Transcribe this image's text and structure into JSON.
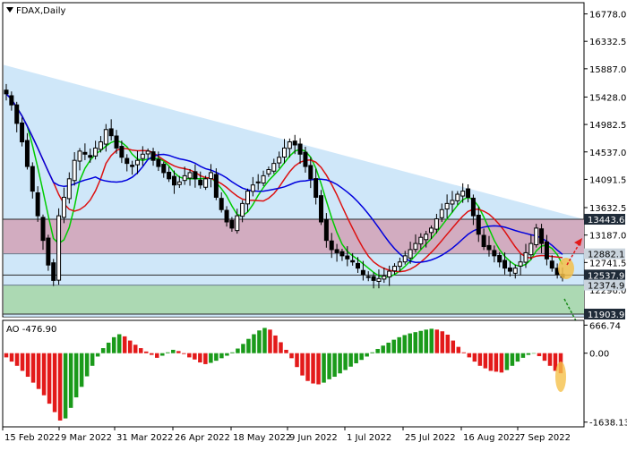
{
  "chart_data": [
    {
      "type": "candlestick",
      "title": "FDAX,Daily",
      "y_ticks": [
        "16778.0",
        "16332.5",
        "15887.0",
        "15428.0",
        "14982.5",
        "14537.0",
        "14091.5",
        "13632.5",
        "13187.0",
        "12741.5",
        "12296.0"
      ],
      "price_labels": [
        {
          "text": "13443.6",
          "value": 13443.6,
          "style": "dark"
        },
        {
          "text": "12882.1",
          "value": 12882.1,
          "style": "light"
        },
        {
          "text": "12537.9",
          "value": 12537.9,
          "style": "dark"
        },
        {
          "text": "12374.9",
          "value": 12374.9,
          "style": "light"
        },
        {
          "text": "11903.9",
          "value": 11903.9,
          "style": "dark"
        }
      ],
      "ylim": [
        11860,
        16960
      ],
      "zones": [
        {
          "from": 12882.1,
          "to": 13443.6,
          "color": "#d4a5b8"
        },
        {
          "from": 11903.9,
          "to": 12374.9,
          "color": "#a9d8a9"
        }
      ],
      "trend_channel": {
        "upper_start": 15950,
        "upper_end": 13443.6,
        "color": "#c3e1f7"
      },
      "moving_averages": [
        {
          "color": "#00cc00"
        },
        {
          "color": "#dd1111"
        },
        {
          "color": "#0000dd"
        }
      ],
      "close_series": [
        15480,
        15300,
        15000,
        14700,
        14300,
        13900,
        13500,
        13100,
        12700,
        12450,
        13500,
        13800,
        14100,
        14400,
        14550,
        14500,
        14450,
        14600,
        14700,
        14900,
        14800,
        14600,
        14450,
        14350,
        14300,
        14400,
        14500,
        14550,
        14400,
        14300,
        14200,
        14100,
        14000,
        14050,
        14150,
        14200,
        14100,
        14000,
        14100,
        14200,
        13800,
        13600,
        13400,
        13300,
        13500,
        13700,
        13900,
        14000,
        14050,
        14150,
        14250,
        14350,
        14450,
        14600,
        14700,
        14650,
        14500,
        14300,
        14100,
        13800,
        13400,
        13100,
        12950,
        12900,
        12850,
        12800,
        12750,
        12650,
        12550,
        12500,
        12450,
        12480,
        12520,
        12600,
        12680,
        12750,
        12850,
        12950,
        13050,
        13150,
        13200,
        13300,
        13450,
        13600,
        13700,
        13750,
        13850,
        13900,
        13800,
        13500,
        13200,
        13000,
        12950,
        12850,
        12750,
        12650,
        12600,
        12650,
        12750,
        12900,
        13050,
        13300,
        13050,
        12800,
        12650,
        12550,
        12500
      ]
    },
    {
      "type": "histogram",
      "title": "AO -476.90",
      "y_ticks": [
        "666.74",
        "0.00",
        "-1638.13"
      ],
      "ylim": [
        -1750,
        780
      ],
      "positive_color": "#1a9a1a",
      "negative_color": "#e31a1a",
      "highlight_color": "#f5a623",
      "values": [
        -100,
        -200,
        -300,
        -420,
        -560,
        -700,
        -850,
        -1000,
        -1200,
        -1400,
        -1600,
        -1550,
        -1300,
        -1050,
        -800,
        -550,
        -300,
        -80,
        120,
        250,
        380,
        450,
        400,
        300,
        200,
        120,
        40,
        -40,
        -110,
        -60,
        20,
        80,
        50,
        -20,
        -100,
        -150,
        -220,
        -260,
        -230,
        -180,
        -120,
        -60,
        20,
        110,
        220,
        340,
        450,
        540,
        600,
        560,
        420,
        260,
        80,
        -120,
        -330,
        -530,
        -660,
        -720,
        -740,
        -700,
        -620,
        -560,
        -480,
        -400,
        -320,
        -240,
        -160,
        -80,
        20,
        100,
        180,
        250,
        320,
        380,
        430,
        470,
        500,
        530,
        560,
        580,
        560,
        520,
        440,
        300,
        150,
        20,
        -100,
        -200,
        -300,
        -360,
        -420,
        -440,
        -460,
        -400,
        -300,
        -200,
        -110,
        -40,
        0,
        -70,
        -180,
        -300,
        -420,
        -476.9
      ]
    }
  ],
  "x_axis": {
    "labels": [
      "15 Feb 2022",
      "9 Mar 2022",
      "31 Mar 2022",
      "26 Apr 2022",
      "18 May 2022",
      "9 Jun 2022",
      "1 Jul 2022",
      "25 Jul 2022",
      "16 Aug 2022",
      "7 Sep 2022"
    ]
  }
}
